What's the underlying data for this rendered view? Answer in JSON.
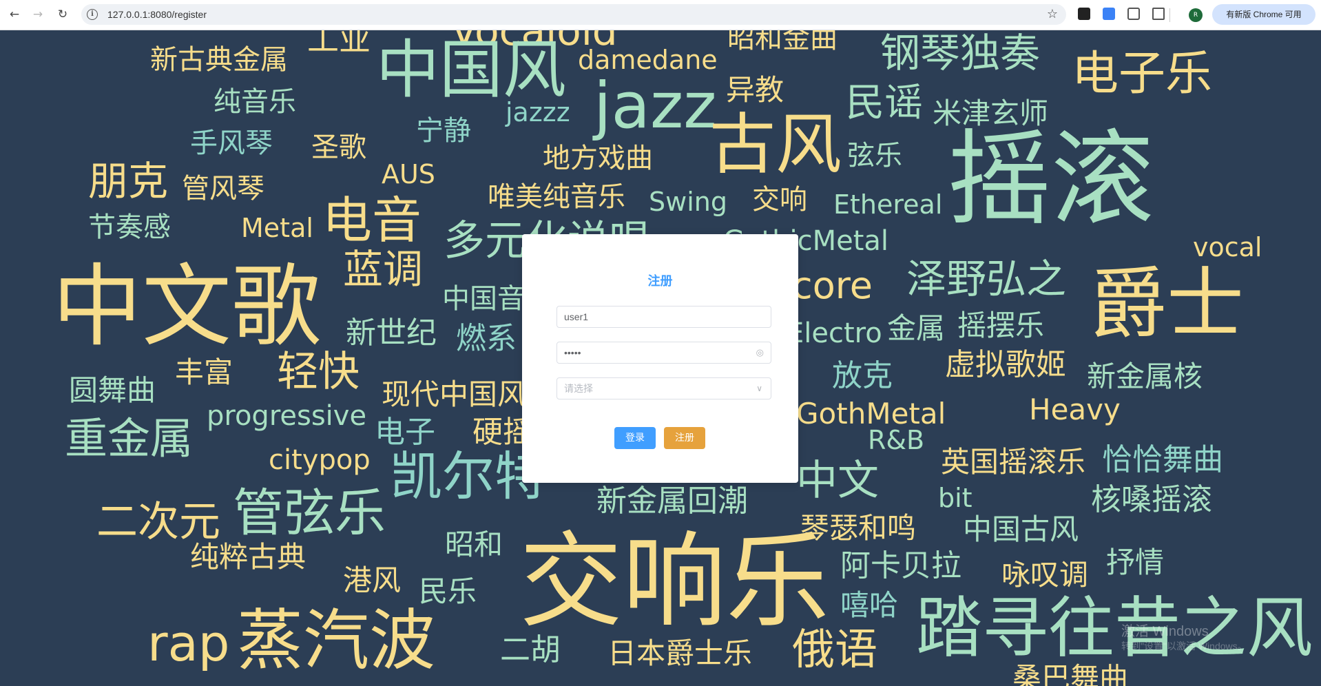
{
  "browser": {
    "url": "127.0.0.1:8080/register",
    "update_label": "有新版 Chrome 可用",
    "profile_initial": "R"
  },
  "words": [
    "工业",
    "Vocaloid",
    "昭和金曲",
    "新古典金属",
    "中国风",
    "damedane",
    "钢琴独奏",
    "电子乐",
    "纯音乐",
    "jazz",
    "异教",
    "民谣",
    "米津玄师",
    "jazzz",
    "手风琴",
    "宁静",
    "圣歌",
    "古风",
    "弦乐",
    "朋克",
    "地方戏曲",
    "摇滚",
    "AUS",
    "管风琴",
    "唯美纯音乐",
    "Swing",
    "交响",
    "Ethereal",
    "节奏感",
    "Metal",
    "电音",
    "多元化说唱",
    "GothicMetal",
    "vocal",
    "蓝调",
    "中文歌",
    "泽野弘之",
    "core",
    "爵士",
    "中国音",
    "新世纪",
    "燃系",
    "Electro",
    "金属",
    "摇摆乐",
    "轻快",
    "丰富",
    "放克",
    "虚拟歌姬",
    "圆舞曲",
    "新金属核",
    "现代中国风",
    "progressive",
    "GothMetal",
    "Heavy",
    "重金属",
    "电子",
    "硬摇",
    "R&B",
    "citypop",
    "凯尔特",
    "中文",
    "英国摇滚乐",
    "恰恰舞曲",
    "二次元",
    "管弦乐",
    "新金属回潮",
    "bit",
    "核嗓摇滚",
    "琴瑟和鸣",
    "中国古风",
    "昭和",
    "纯粹古典",
    "交响乐",
    "阿卡贝拉",
    "抒情",
    "港风",
    "民乐",
    "咏叹调",
    "嘻哈",
    "rap",
    "蒸汽波",
    "二胡",
    "日本爵士乐",
    "俄语",
    "踏寻往昔之风",
    "桑巴舞曲"
  ],
  "dialog": {
    "title": "注册",
    "username_value": "user1",
    "password_value": "•••••",
    "select_placeholder": "请选择",
    "login_label": "登录",
    "register_label": "注册"
  },
  "watermark": {
    "line1": "激活 Windows",
    "line2": "转到\"设置\"以激活 Windows。"
  },
  "colors": {
    "background": "#2c3e55",
    "accent": "#409eff",
    "register_button": "#e6a23c",
    "word_yellow": "#f7dd8b",
    "word_green": "#a8e0c2"
  }
}
